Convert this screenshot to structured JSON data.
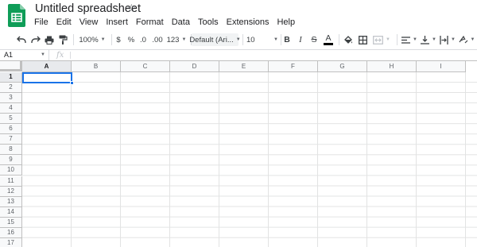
{
  "title": "Untitled spreadsheet",
  "menu": [
    "File",
    "Edit",
    "View",
    "Insert",
    "Format",
    "Data",
    "Tools",
    "Extensions",
    "Help"
  ],
  "toolbar": {
    "zoom": "100%",
    "currency": "$",
    "percent": "%",
    "decrease_decimals": ".0",
    "increase_decimals": ".00",
    "more_formats": "123",
    "font": "Default (Ari...",
    "font_size": "10",
    "bold": "B",
    "italic": "I",
    "strikethrough": "S",
    "text_color_letter": "A",
    "text_color": "#000000"
  },
  "formula_bar": {
    "name_box": "A1",
    "fx": "fx",
    "value": ""
  },
  "columns": [
    "A",
    "B",
    "C",
    "D",
    "E",
    "F",
    "G",
    "H",
    "I"
  ],
  "rows": [
    "1",
    "2",
    "3",
    "4",
    "5",
    "6",
    "7",
    "8",
    "9",
    "10",
    "11",
    "12",
    "13",
    "14",
    "15",
    "16",
    "17"
  ],
  "selected_cell": "A1",
  "colors": {
    "accent": "#1a73e8",
    "logo_green": "#0f9d58"
  }
}
